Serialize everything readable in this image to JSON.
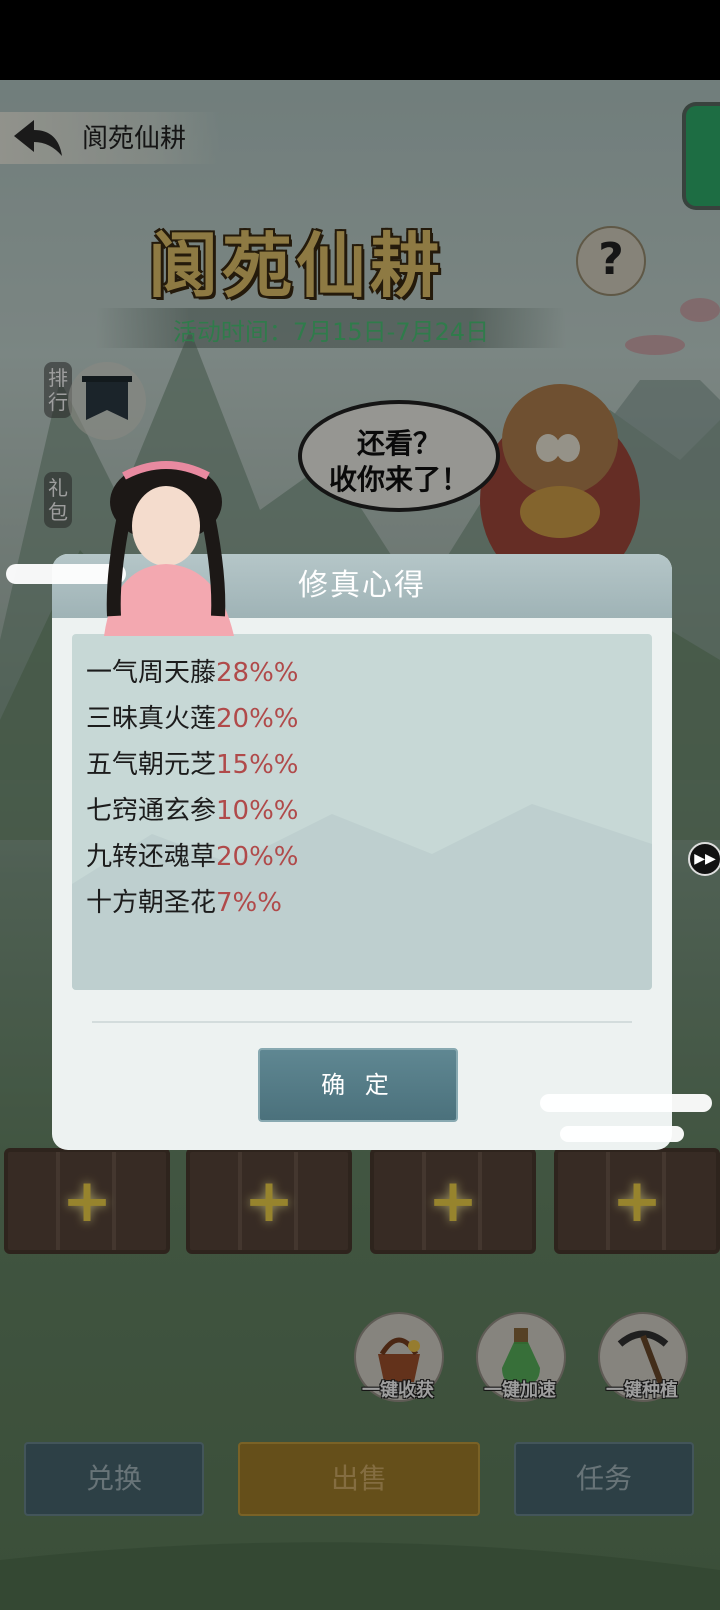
{
  "header": {
    "title": "阆苑仙耕"
  },
  "banner": {
    "title": "阆苑仙耕",
    "help": "?",
    "event_time": "活动时间：7月15日-7月24日"
  },
  "side_menu": {
    "rank": "排行",
    "gift": "礼包"
  },
  "speech_bubble": {
    "line1": "还看？",
    "line2": "收你来了！"
  },
  "plots": {
    "add_symbol": "+"
  },
  "tools": [
    {
      "label": "一键收获",
      "icon": "harvest-basket-icon"
    },
    {
      "label": "一键加速",
      "icon": "potion-bottle-icon"
    },
    {
      "label": "一键种植",
      "icon": "pickaxe-icon"
    }
  ],
  "bottom_buttons": {
    "exchange": "兑换",
    "sell": "出售",
    "tasks": "任务"
  },
  "dialog": {
    "title": "修真心得",
    "items": [
      {
        "name": "一气周天藤",
        "pct": "28%%"
      },
      {
        "name": "三昧真火莲",
        "pct": "20%%"
      },
      {
        "name": "五气朝元芝",
        "pct": "15%%"
      },
      {
        "name": "七窍通玄参",
        "pct": "10%%"
      },
      {
        "name": "九转还魂草",
        "pct": "20%%"
      },
      {
        "name": "十方朝圣花",
        "pct": "7%%"
      }
    ],
    "confirm": "确 定"
  },
  "colors": {
    "accent_gold": "#e5c56c",
    "event_green": "#4ec77a",
    "pct_red": "#b04a4a"
  }
}
